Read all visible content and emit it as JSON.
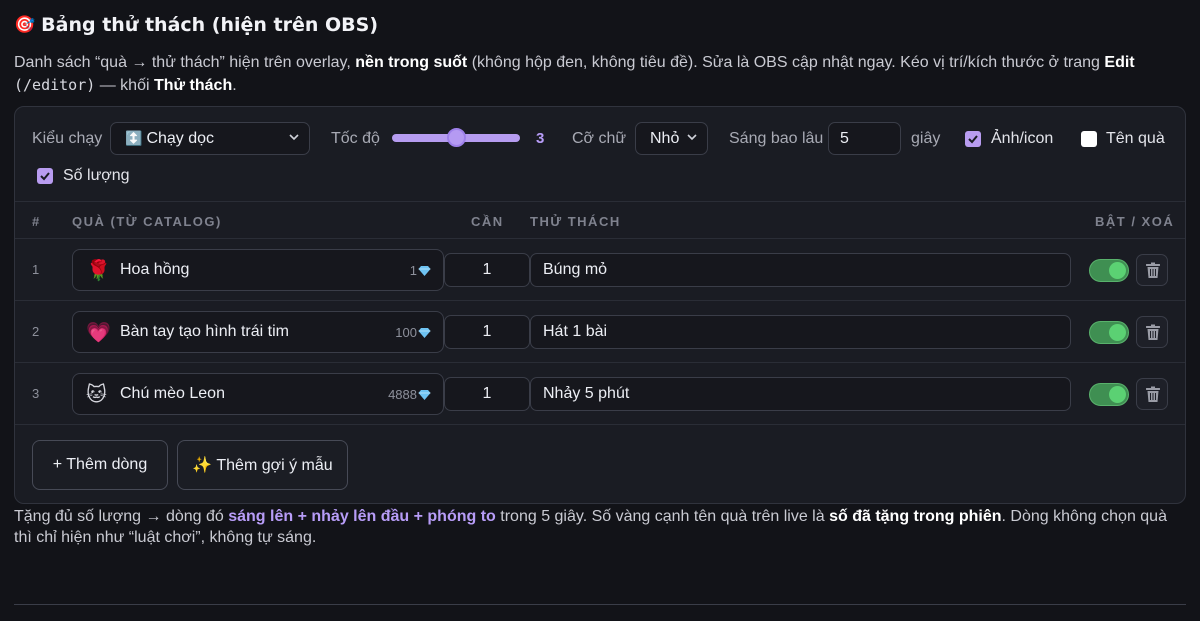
{
  "title": {
    "emoji": "🎯",
    "text": "Bảng thử thách (hiện trên OBS)"
  },
  "description": {
    "part1": "Danh sách “quà → thử thách” hiện trên overlay, ",
    "bold1": "nền trong suốt",
    "part2": " (không hộp đen, không tiêu đề). Sửa là OBS cập nhật ngay. Kéo vị trí/kích thước ở trang ",
    "bold2": "Edit",
    "code": " (/editor)",
    "part3": " — khối ",
    "bold3": "Thử thách",
    "part4": "."
  },
  "controls": {
    "mode_label": "Kiểu chạy",
    "mode_emoji": "↕️",
    "mode_value": "Chạy dọc",
    "speed_label": "Tốc độ",
    "speed_value": "3",
    "speed_fraction": 0.5,
    "font_label": "Cỡ chữ",
    "font_value": "Nhỏ",
    "duration_label": "Sáng bao lâu",
    "duration_value": "5",
    "duration_unit": "giây",
    "image_icon": {
      "label": "Ảnh/icon",
      "checked": true
    },
    "gift_name": {
      "label": "Tên quà",
      "checked": false
    },
    "quantity": {
      "label": "Số lượng",
      "checked": true
    }
  },
  "table": {
    "headers": {
      "index": "#",
      "gift": "QUÀ (TỪ CATALOG)",
      "need": "CẦN",
      "challenge": "THỬ THÁCH",
      "actions": "BẬT / XOÁ"
    },
    "rows": [
      {
        "index": "1",
        "icon": "🌹",
        "gift": "Hoa hồng",
        "price": "1",
        "need": "1",
        "challenge": "Búng mỏ",
        "enabled": true
      },
      {
        "index": "2",
        "icon": "💗",
        "gift": "Bàn tay tạo hình trái tim",
        "price": "100",
        "need": "1",
        "challenge": "Hát 1 bài",
        "enabled": true
      },
      {
        "index": "3",
        "icon": "🐱",
        "gift": "Chú mèo Leon",
        "price": "4888",
        "need": "1",
        "challenge": "Nhảy 5 phút",
        "enabled": true
      }
    ]
  },
  "buttons": {
    "add_row": "+ Thêm dòng",
    "add_sample": "✨ Thêm gợi ý mẫu"
  },
  "footer": {
    "part1": "Tặng đủ số lượng → dòng đó ",
    "hl1": "sáng lên + nhảy lên đầu + phóng to",
    "part2": " trong 5 giây. Số vàng cạnh tên quà trên live là ",
    "bold1": "số đã tặng trong phiên",
    "part3": ". Dòng không chọn quà thì chỉ hiện như “luật chơi”, không tự sáng."
  },
  "colors": {
    "accent": "#b79cf7",
    "toggle_on": "#5bd173",
    "diamond": "#6ec3f2"
  }
}
